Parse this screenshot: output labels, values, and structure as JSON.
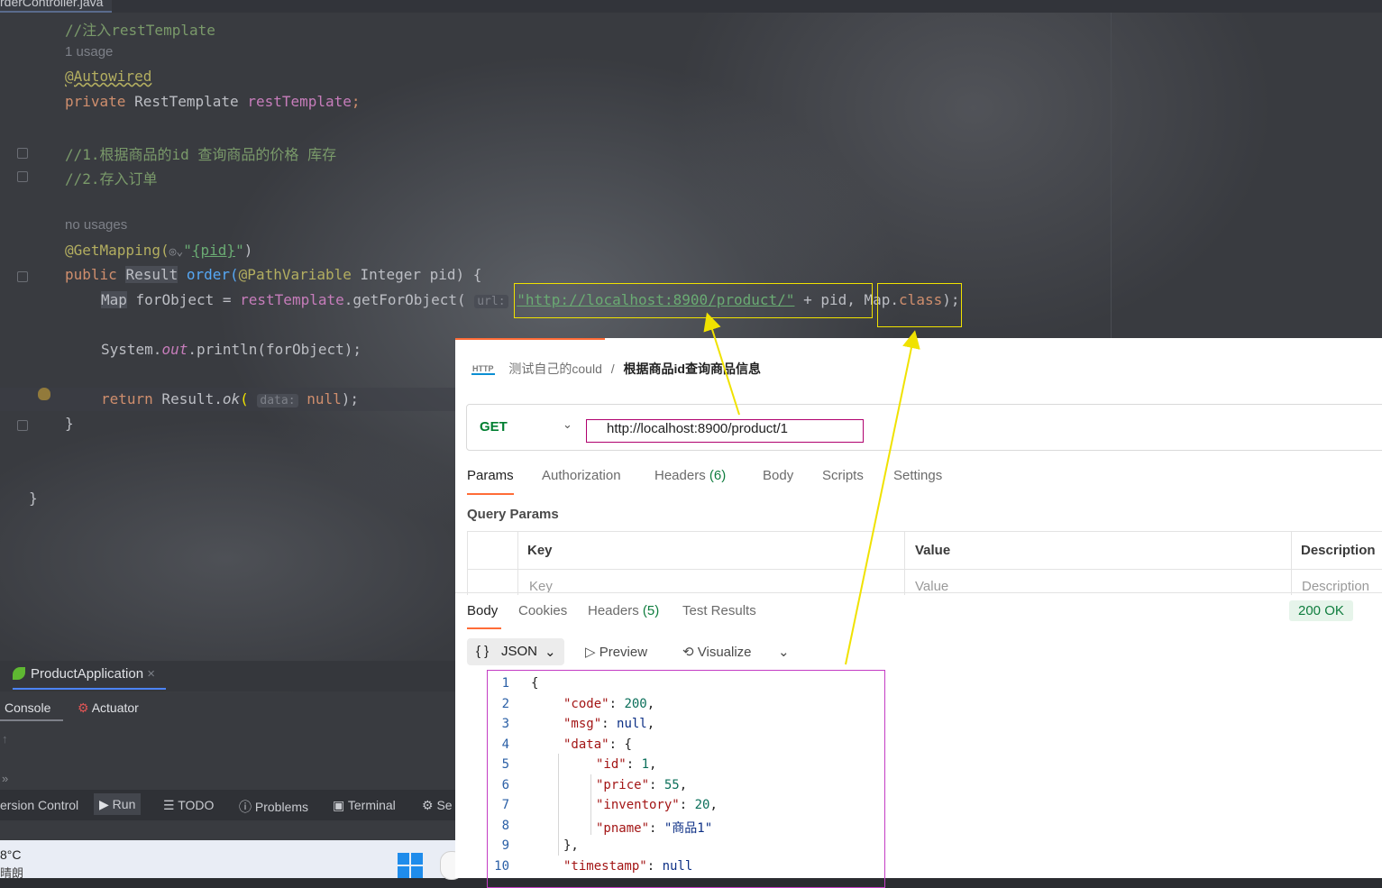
{
  "ide": {
    "file_tab": "rderController.java",
    "code": {
      "comment_inject": "//注入restTemplate",
      "usage_hint": "1 usage",
      "autowired": "@Autowired",
      "private_kw": "private",
      "rest_type": "RestTemplate",
      "rest_field": "restTemplate",
      "semicolon": ";",
      "comment1": "//1.根据商品的id 查询商品的价格 库存",
      "comment2": "//2.存入订单",
      "no_usages": "no usages",
      "get_mapping": "@GetMapping(",
      "get_mapping_path": "{pid}",
      "public_kw": "public",
      "result_type": "Result",
      "method_name": "order(",
      "path_variable": "@PathVariable",
      "params": " Integer pid) {",
      "map_type": "Map",
      "for_object_decl": " forObject = ",
      "rest_call_obj": "restTemplate",
      "rest_call_method": ".getForObject(",
      "url_hint": "url:",
      "url_string": "\"http://localhost:8900/product/\"",
      "plus_pid": " + pid,",
      "map_class_a": "Map.",
      "map_class_b": "class",
      "close_paren": ");",
      "println_a": "System.",
      "println_out": "out",
      "println_b": ".println(forObject);",
      "return_kw": "return",
      "result_ok_a": " Result.",
      "result_ok_b": "ok",
      "paren_open": "(",
      "data_hint": "data:",
      "null_kw": "null",
      "close_brace_1": "}",
      "close_brace_2": "}"
    },
    "run_tab": "ProductApplication",
    "console_tabs": [
      "Console",
      "Actuator"
    ],
    "bottom_tabs": [
      "ersion Control",
      "Run",
      "TODO",
      "Problems",
      "Terminal",
      "Se"
    ],
    "weather": {
      "temp": "8°C",
      "condition": "晴朗"
    }
  },
  "postman": {
    "breadcrumb": {
      "collection": "测试自己的could",
      "separator": "/",
      "request": "根据商品id查询商品信息"
    },
    "http_icon": "HTTP",
    "method": "GET",
    "url": "http://localhost:8900/product/1",
    "request_tabs": [
      {
        "label": "Params",
        "count": ""
      },
      {
        "label": "Authorization",
        "count": ""
      },
      {
        "label": "Headers",
        "count": "(6)"
      },
      {
        "label": "Body",
        "count": ""
      },
      {
        "label": "Scripts",
        "count": ""
      },
      {
        "label": "Settings",
        "count": ""
      }
    ],
    "query_params_title": "Query Params",
    "table_headers": [
      "Key",
      "Value",
      "Description"
    ],
    "table_placeholders": [
      "Key",
      "Value",
      "Description"
    ],
    "response_tabs": [
      {
        "label": "Body",
        "count": ""
      },
      {
        "label": "Cookies",
        "count": ""
      },
      {
        "label": "Headers",
        "count": "(5)"
      },
      {
        "label": "Test Results",
        "count": ""
      }
    ],
    "status": "200 OK",
    "format": "JSON",
    "format_icon": "{ }",
    "preview": "Preview",
    "visualize": "Visualize",
    "json_lines": [
      {
        "n": "1",
        "indent": 0,
        "key": "",
        "value": "{",
        "vtype": "p"
      },
      {
        "n": "2",
        "indent": 1,
        "key": "\"code\"",
        "value": "200",
        "vtype": "num",
        "tail": ","
      },
      {
        "n": "3",
        "indent": 1,
        "key": "\"msg\"",
        "value": "null",
        "vtype": "null",
        "tail": ","
      },
      {
        "n": "4",
        "indent": 1,
        "key": "\"data\"",
        "value": "{",
        "vtype": "p",
        "tail": ""
      },
      {
        "n": "5",
        "indent": 2,
        "key": "\"id\"",
        "value": "1",
        "vtype": "num",
        "tail": ","
      },
      {
        "n": "6",
        "indent": 2,
        "key": "\"price\"",
        "value": "55",
        "vtype": "num",
        "tail": ","
      },
      {
        "n": "7",
        "indent": 2,
        "key": "\"inventory\"",
        "value": "20",
        "vtype": "num",
        "tail": ","
      },
      {
        "n": "8",
        "indent": 2,
        "key": "\"pname\"",
        "value": "\"商品1\"",
        "vtype": "str",
        "tail": ""
      },
      {
        "n": "9",
        "indent": 1,
        "key": "",
        "value": "},",
        "vtype": "p"
      },
      {
        "n": "10",
        "indent": 1,
        "key": "\"timestamp\"",
        "value": "null",
        "vtype": "null",
        "tail": ""
      }
    ]
  },
  "colors": {
    "annotation_yellow": "#f0e200",
    "url_box_magenta": "#b0006e",
    "json_box_magenta": "#c43dc4",
    "postman_orange": "#ff6c37",
    "status_green": "#0f7d3e"
  }
}
